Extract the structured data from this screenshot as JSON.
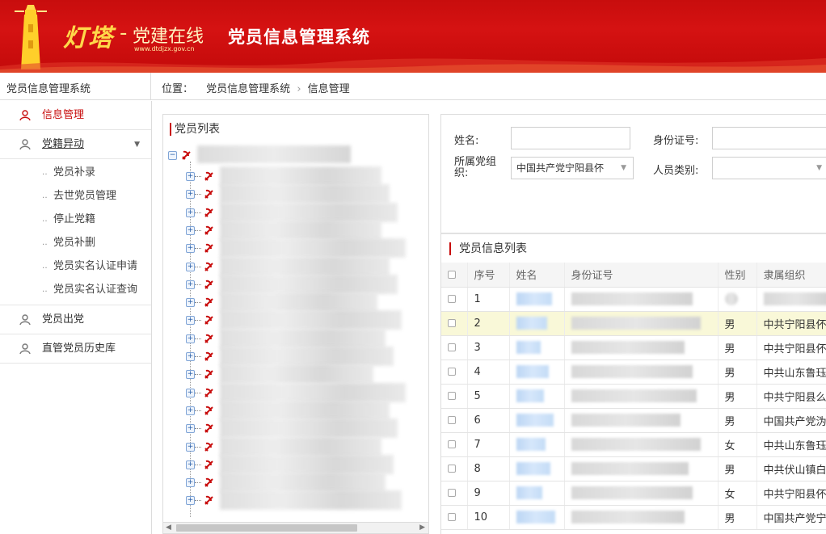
{
  "header": {
    "logo_main": "灯塔",
    "logo_dash": "-",
    "logo_sub": "党建在线",
    "logo_url": "www.dtdjzx.gov.cn",
    "system_title": "党员信息管理系统",
    "brand_color": "#c80d0d"
  },
  "topbar": {
    "system_label": "党员信息管理系统",
    "breadcrumb_prefix": "位置：",
    "breadcrumb_1": "党员信息管理系统",
    "breadcrumb_sep": "›",
    "breadcrumb_2": "信息管理"
  },
  "sidebar": {
    "items": [
      {
        "label": "信息管理",
        "icon": "party-member-icon",
        "active": true
      },
      {
        "label": "党籍异动",
        "icon": "party-member-icon",
        "expanded": true
      },
      {
        "label": "党员出党",
        "icon": "party-member-icon"
      },
      {
        "label": "直管党员历史库",
        "icon": "party-member-icon"
      }
    ],
    "submenu": [
      {
        "label": "党员补录"
      },
      {
        "label": "去世党员管理"
      },
      {
        "label": "停止党籍"
      },
      {
        "label": "党员补删"
      },
      {
        "label": "党员实名认证申请"
      },
      {
        "label": "党员实名认证查询"
      }
    ]
  },
  "tree": {
    "title": "党员列表"
  },
  "search": {
    "name_label": "姓名:",
    "id_label": "身份证号:",
    "org_label": "所属党组织:",
    "org_value": "中国共产党宁阳县伓",
    "category_label": "人员类别:",
    "name_value": "",
    "id_value": "",
    "category_value": ""
  },
  "list": {
    "title": "党员信息列表",
    "columns": [
      "",
      "序号",
      "姓名",
      "身份证号",
      "性别",
      "隶属组织"
    ],
    "rows": [
      {
        "no": "1",
        "gender": "",
        "org": ""
      },
      {
        "no": "2",
        "gender": "男",
        "org": "中共宁阳县伓"
      },
      {
        "no": "3",
        "gender": "男",
        "org": "中共宁阳县伓"
      },
      {
        "no": "4",
        "gender": "男",
        "org": "中共山东鲁珏会"
      },
      {
        "no": "5",
        "gender": "男",
        "org": "中共宁阳县么"
      },
      {
        "no": "6",
        "gender": "男",
        "org": "中国共产党沩"
      },
      {
        "no": "7",
        "gender": "女",
        "org": "中共山东鲁珏"
      },
      {
        "no": "8",
        "gender": "男",
        "org": "中共伏山镇白"
      },
      {
        "no": "9",
        "gender": "女",
        "org": "中共宁阳县伓"
      },
      {
        "no": "10",
        "gender": "男",
        "org": "中国共产党宁"
      }
    ]
  }
}
